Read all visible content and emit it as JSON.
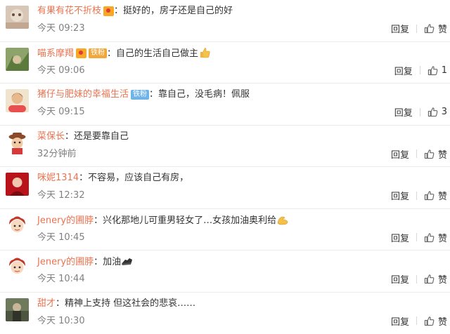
{
  "comments": [
    {
      "username": "有果有花不折枝",
      "text": "：挺好的，房子还是自己的好",
      "time": "今天 09:23",
      "reply_label": "回复",
      "like_label": "赞"
    },
    {
      "username": "喵系摩羯",
      "badge": "铁粉",
      "text": "：自己的生活自己做主",
      "time": "今天 09:06",
      "reply_label": "回复",
      "like_label": "1"
    },
    {
      "username": "猪仔与肥妹的幸福生活",
      "badge": "铁粉",
      "text": "：靠自己，没毛病！佩服",
      "time": "今天 09:15",
      "reply_label": "回复",
      "like_label": "3"
    },
    {
      "username": "菜保长",
      "text": "：还是要靠自己",
      "time": "32分钟前",
      "reply_label": "回复",
      "like_label": "赞"
    },
    {
      "username": "咪妮1314",
      "text": "：不容易，应该自己有房，",
      "time": "今天 12:32",
      "reply_label": "回复",
      "like_label": "赞"
    },
    {
      "username": "Jenery的圃脖",
      "text": "：兴化那地儿可重男轻女了…女孩加油奥利给",
      "time": "今天 10:45",
      "reply_label": "回复",
      "like_label": "赞"
    },
    {
      "username": "Jenery的圃脖",
      "text": "：加油",
      "time": "今天 10:44",
      "reply_label": "回复",
      "like_label": "赞"
    },
    {
      "username": "甜才",
      "text": "：精神上支持 但这社会的悲哀……",
      "time": "今天 10:30",
      "reply_label": "回复",
      "like_label": "赞"
    }
  ],
  "icons": {
    "vip": "vip-crown-icon",
    "like": "thumbs-up-icon",
    "emoji_thumb": "thumbs-up-emoji-icon",
    "emoji_muscle": "flexed-biceps-emoji-icon",
    "emoji_strong": "muscle-arm-emoji-icon"
  },
  "colors": {
    "username": "#eb7350",
    "username_blue": "#3c78c3",
    "time": "#808080",
    "badge_gold": "#f0a73b",
    "badge_blue": "#6fb3e8"
  }
}
